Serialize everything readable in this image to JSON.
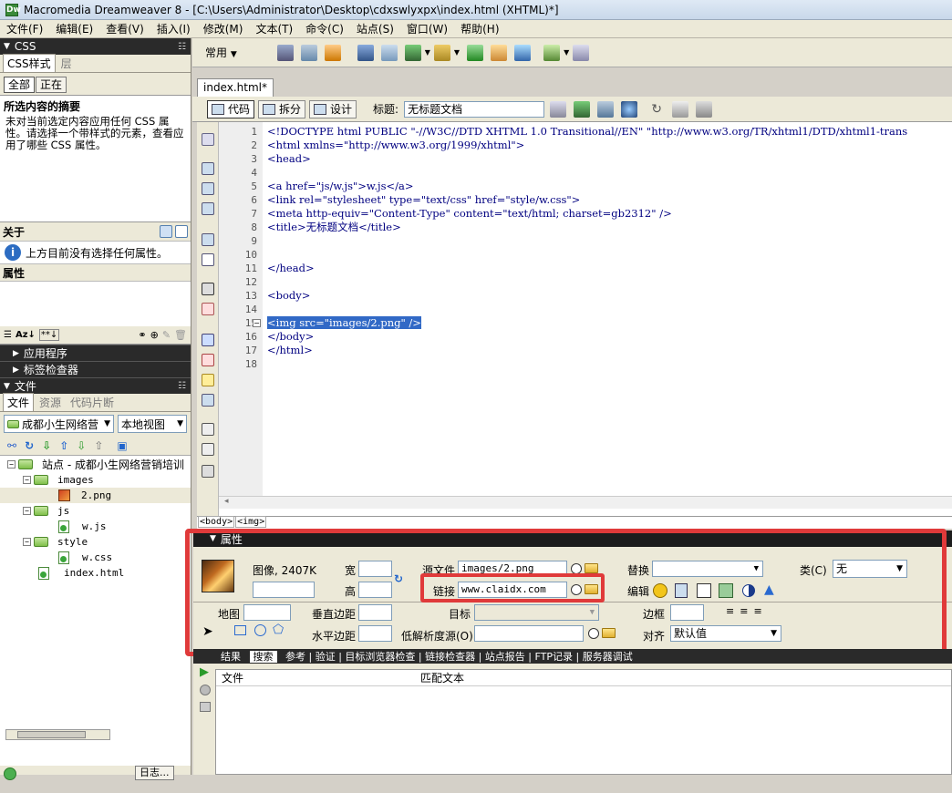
{
  "window": {
    "title": "Macromedia Dreamweaver 8 - [C:\\Users\\Administrator\\Desktop\\cdxswlyxpx\\index.html (XHTML)*]"
  },
  "menu": [
    "文件(F)",
    "编辑(E)",
    "查看(V)",
    "插入(I)",
    "修改(M)",
    "文本(T)",
    "命令(C)",
    "站点(S)",
    "窗口(W)",
    "帮助(H)"
  ],
  "insertbar": {
    "category": "常用"
  },
  "css_panel": {
    "header": "CSS",
    "tabs": [
      "CSS样式",
      "层"
    ],
    "mode_buttons": [
      "全部",
      "正在"
    ],
    "summary_title": "所选内容的摘要",
    "summary_text": "未对当前选定内容应用任何 CSS 属性。请选择一个带样式的元素，查看应用了哪些 CSS 属性。",
    "about_title": "关于",
    "about_text": "上方目前没有选择任何属性。",
    "props_title": "属性"
  },
  "collapsed_panels": [
    "应用程序",
    "标签检查器"
  ],
  "files_panel": {
    "header": "文件",
    "tabs": [
      "文件",
      "资源",
      "代码片断"
    ],
    "site_select": "成都小生网络营",
    "view_select": "本地视图",
    "tree": [
      {
        "label": "站点 - 成都小生网络营销培训",
        "type": "site"
      },
      {
        "label": "images",
        "type": "folder"
      },
      {
        "label": "2.png",
        "type": "png"
      },
      {
        "label": "js",
        "type": "folder"
      },
      {
        "label": "w.js",
        "type": "file"
      },
      {
        "label": "style",
        "type": "folder"
      },
      {
        "label": "w.css",
        "type": "file"
      },
      {
        "label": "index.html",
        "type": "file"
      }
    ],
    "log_button": "日志..."
  },
  "document": {
    "tab": "index.html*",
    "view_buttons": [
      "代码",
      "拆分",
      "设计"
    ],
    "title_label": "标题:",
    "title_value": "无标题文档",
    "lines": [
      {
        "n": "1",
        "text": "<!DOCTYPE html PUBLIC \"-//W3C//DTD XHTML 1.0 Transitional//EN\" \"http://www.w3.org/TR/xhtml1/DTD/xhtml1-trans"
      },
      {
        "n": "2",
        "text": "<html xmlns=\"http://www.w3.org/1999/xhtml\">"
      },
      {
        "n": "3",
        "text": "<head>"
      },
      {
        "n": "4",
        "text": ""
      },
      {
        "n": "5",
        "text": "<a href=\"js/w.js\">w.js</a>"
      },
      {
        "n": "6",
        "text": "<link rel=\"stylesheet\" type=\"text/css\" href=\"style/w.css\">"
      },
      {
        "n": "7",
        "text": "<meta http-equiv=\"Content-Type\" content=\"text/html; charset=gb2312\" />"
      },
      {
        "n": "8",
        "text": "<title>无标题文档</title>"
      },
      {
        "n": "9",
        "text": ""
      },
      {
        "n": "10",
        "text": ""
      },
      {
        "n": "11",
        "text": "</head>"
      },
      {
        "n": "12",
        "text": ""
      },
      {
        "n": "13",
        "text": "<body>"
      },
      {
        "n": "14",
        "text": ""
      },
      {
        "n": "15",
        "text": "<img src=\"images/2.png\" />"
      },
      {
        "n": "16",
        "text": "</body>"
      },
      {
        "n": "17",
        "text": "</html>"
      },
      {
        "n": "18",
        "text": ""
      }
    ],
    "tag_selector": [
      "<body>",
      "<img>"
    ]
  },
  "properties": {
    "header": "属性",
    "image_label": "图像, 2407K",
    "width_label": "宽",
    "height_label": "高",
    "src_label": "源文件",
    "src_value": "images/2.png",
    "link_label": "链接",
    "link_value": "www.claidx.com",
    "alt_label": "替换",
    "edit_label": "编辑",
    "class_label": "类(C)",
    "class_value": "无",
    "map_label": "地图",
    "vspace_label": "垂直边距",
    "hspace_label": "水平边距",
    "target_label": "目标",
    "lowsrc_label": "低解析度源(O)",
    "border_label": "边框",
    "align_label": "对齐",
    "align_value": "默认值"
  },
  "results": {
    "tabs": [
      "结果",
      "搜索",
      "参考",
      "验证",
      "目标浏览器检查",
      "链接检查器",
      "站点报告",
      "FTP记录",
      "服务器调试"
    ],
    "columns": [
      "文件",
      "匹配文本"
    ]
  }
}
